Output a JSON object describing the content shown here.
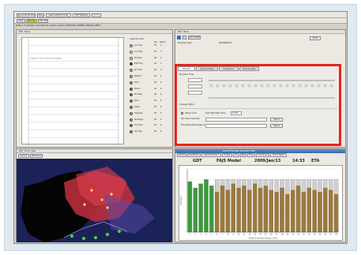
{
  "window": {
    "menu": [
      "Ignore Route Edit",
      "Save",
      "Save As/Edit Config",
      "QDT Settings",
      "Ignore"
    ],
    "tabs": [
      "PEAK",
      "SEA-TAC",
      "VRD TIB"
    ],
    "status_line": "Position of last flight: airport/arrival: position_one/LAX_WESTGATE_CORNER_ARRIVALS_DELTA"
  },
  "top_left_plot": {
    "menu": [
      "Edit",
      "Show"
    ],
    "placeholder": "Flower Rise Not Available",
    "legend_title": "Legend Color",
    "legend_header": [
      "Sel",
      "Sector"
    ],
    "legend_rows": [
      {
        "label": "Loc Flow",
        "a": "XS",
        "b": "3",
        "color": "#c0c0c0"
      },
      {
        "label": "Loc Flow",
        "a": "XS",
        "b": "3",
        "color": "#ffffff"
      },
      {
        "label": "Fix Flow",
        "a": "XS",
        "b": "4",
        "color": "#f0f0f0"
      },
      {
        "label": "Dpt Flow",
        "a": "XS",
        "b": "4",
        "color": "#101010"
      },
      {
        "label": "Arr Flow",
        "a": "XS",
        "b": "4",
        "color": "#c8c8c8"
      },
      {
        "label": "Peak Hr",
        "a": "XS",
        "b": "6",
        "color": "#e0c020"
      },
      {
        "label": "Total",
        "a": "XS",
        "b": "6",
        "color": "#d08020"
      },
      {
        "label": "Est Arr",
        "a": "XS",
        "b": "6",
        "color": "#2050c0"
      },
      {
        "label": "Tfc Rate",
        "a": "XS",
        "b": "6",
        "color": "#d03030"
      },
      {
        "label": "Hold",
        "a": "XS",
        "b": "6",
        "color": "#40a040"
      },
      {
        "label": "Delay",
        "a": "XS",
        "b": "6",
        "color": "#808080"
      },
      {
        "label": "Capacity",
        "a": "XS",
        "b": "6",
        "color": "#f0a030"
      },
      {
        "label": "Tot Delay",
        "a": "XS",
        "b": "6",
        "color": "#a0a0a0"
      },
      {
        "label": "Ovr Dmd",
        "a": "XS",
        "b": "6",
        "color": "#3060d0"
      },
      {
        "label": "Ovr Cap",
        "a": "XS",
        "b": "6",
        "color": "#50b050"
      }
    ]
  },
  "right_panel": {
    "menu": [
      "Edit",
      "Show"
    ],
    "program_type_label": "Program Type",
    "program_type_value": "GDT MODE",
    "program_date": "2009/JAN/13",
    "send_button": "Send",
    "tabs": [
      "General",
      "Program Rates",
      "Exemptions",
      "Planning Rate"
    ],
    "section1": "Program Time",
    "section2": "Change Option",
    "field1_label": "Delay Limit",
    "field1_value": "Last Edit Start Time",
    "field1_time": "14:00",
    "field2_label": "Sub Field Override",
    "field3_label": "Exemptions/Exceptions",
    "select_button": "Select"
  },
  "map_pane": {
    "menu": [
      "Edit",
      "Show",
      "View"
    ],
    "tabs": [
      "Airport",
      "Monitored"
    ]
  },
  "chart_pane": {
    "title_bar": "Airport Flow Rate Time Line - DEN",
    "tabs": [
      "Airport",
      "Monitored",
      "Airport Monitor",
      "Flights",
      "Arr",
      "Dpt",
      "Flow",
      "Combined",
      "Hold Flights"
    ],
    "header_mode": "GDT",
    "header_model": "FAJS Model",
    "header_date": "2009/Jan/13",
    "header_time": "14:33",
    "header_eta": "ETA",
    "ylabel": "Demand",
    "xlabel": "Time of Arrival (Hours, UTC)"
  },
  "chart_data": {
    "type": "bar",
    "title": "",
    "ylabel": "Demand",
    "xlabel": "Time of Arrival (Hours, UTC)",
    "ylim": [
      0,
      60
    ],
    "categories": [
      "1",
      "2",
      "3",
      "4",
      "5",
      "6",
      "7",
      "8",
      "9",
      "10",
      "11",
      "12",
      "13",
      "14",
      "15",
      "16",
      "17",
      "18",
      "19",
      "20",
      "21",
      "22",
      "23",
      "24",
      "25",
      "26",
      "27",
      "28"
    ],
    "series": [
      {
        "color": "#3c9a3c",
        "values": [
          48,
          42,
          46,
          50,
          44,
          0,
          0,
          0,
          0,
          0,
          0,
          0,
          0,
          0,
          0,
          0,
          0,
          0,
          0,
          0,
          0,
          0,
          0,
          0,
          0,
          0,
          0,
          0
        ]
      },
      {
        "color": "#9c7a3c",
        "values": [
          0,
          0,
          0,
          0,
          0,
          38,
          44,
          40,
          46,
          42,
          44,
          40,
          46,
          42,
          44,
          40,
          38,
          42,
          36,
          40,
          44,
          38,
          42,
          40,
          38,
          42,
          40,
          36
        ]
      },
      {
        "color": "#cfcfcf",
        "values": [
          0,
          0,
          0,
          0,
          0,
          50,
          50,
          50,
          50,
          50,
          50,
          50,
          50,
          50,
          50,
          50,
          50,
          50,
          50,
          50,
          50,
          50,
          50,
          50,
          50,
          50,
          50,
          50
        ]
      }
    ],
    "grid": true
  }
}
